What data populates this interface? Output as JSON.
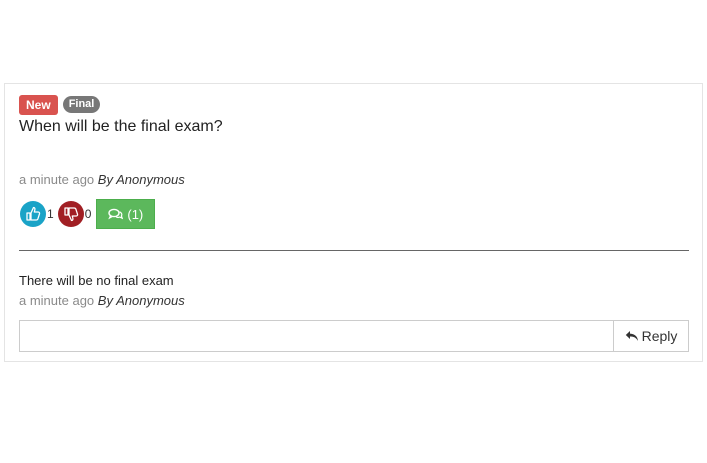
{
  "post": {
    "badges": {
      "new": "New",
      "final": "Final"
    },
    "question": "When will be the final exam?",
    "meta": {
      "time": "a minute ago",
      "author": "By Anonymous"
    },
    "upvotes": "1",
    "downvotes": "0",
    "comments_label": "(1)",
    "icons": {
      "up": "thumbs-up-icon",
      "down": "thumbs-down-icon",
      "comments": "comments-icon",
      "reply": "reply-icon"
    },
    "colors": {
      "new_badge": "#d9534f",
      "final_badge": "#777777",
      "upvote": "#1aa3c7",
      "downvote": "#a11f24",
      "comments_button": "#5cb85c"
    }
  },
  "answer": {
    "text": "There will be no final exam",
    "meta": {
      "time": "a minute ago",
      "author": "By Anonymous"
    }
  },
  "reply": {
    "input_value": "",
    "button_label": "Reply"
  }
}
